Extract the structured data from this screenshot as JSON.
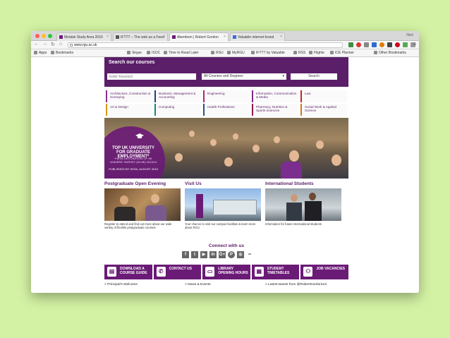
{
  "browser": {
    "tabs": [
      {
        "title": "Module Study Area 2016",
        "active": false
      },
      {
        "title": "IFTTT – The web as a Feed",
        "active": false
      },
      {
        "title": "Aberdeen | Robert Gordon",
        "active": true
      },
      {
        "title": "Valuable internet brand",
        "active": false
      }
    ],
    "user": "Nick",
    "url": "www.rgu.ac.uk",
    "bookmarks": [
      "Apps",
      "Bookmarks",
      "Skype",
      "ISOC",
      "Time to Read Later",
      "RSU",
      "MyRGU",
      "IFTTT by Valuable",
      "RSS",
      "Flights",
      "ICE Planner",
      "Other Bookmarks"
    ]
  },
  "search": {
    "title": "Search our courses",
    "placeholder": "Enter Keyword",
    "select_value": "All Courses and Degrees",
    "button": "Search"
  },
  "subjects": [
    "Architecture, Construction & Surveying",
    "Business, Management & Accounting",
    "Engineering",
    "Information, Communication & Media",
    "Law",
    "Art & Design",
    "Computing",
    "Health Professions",
    "Pharmacy, Nutrition & Sports Sciences",
    "Social Work & Applied Science"
  ],
  "hero": {
    "headline": "TOP UK UNIVERSITY FOR GRADUATE EMPLOYMENT*",
    "sub": "*HESA DESTINATION OF UK LEAVERS' SURVEY (DLHE) 2013/14",
    "published": "PUBLISHED BY HESA, AUGUST 2015"
  },
  "promos": [
    {
      "title": "Postgraduate Open Evening",
      "caption": "Register to attend and find out more about our wide variety of flexible postgraduate courses"
    },
    {
      "title": "Visit Us",
      "caption": "Your chance to visit our campus facilities & learn more about RGU"
    },
    {
      "title": "International Students",
      "caption": "Information for future international students"
    }
  ],
  "connect": {
    "title": "Connect with us",
    "icons": [
      "f",
      "t",
      "▶",
      "in",
      "G+",
      "P",
      "◎",
      "••"
    ]
  },
  "quick_links": [
    {
      "label": "DOWNLOAD A COURSE GUIDE",
      "icon": "▤"
    },
    {
      "label": "CONTACT US",
      "icon": "✆"
    },
    {
      "label": "LIBRARY OPENING HOURS",
      "icon": "▭"
    },
    {
      "label": "STUDENT TIMETABLES",
      "icon": "▦"
    },
    {
      "label": "JOB VACANCIES",
      "icon": "⚇"
    }
  ],
  "footer": [
    "> Principal's Welcome",
    "> News & Events",
    "> Latest tweets from @RobertGordonUni"
  ],
  "colors": {
    "brand": "#5b1e68",
    "brand_light": "#6a1b76"
  }
}
